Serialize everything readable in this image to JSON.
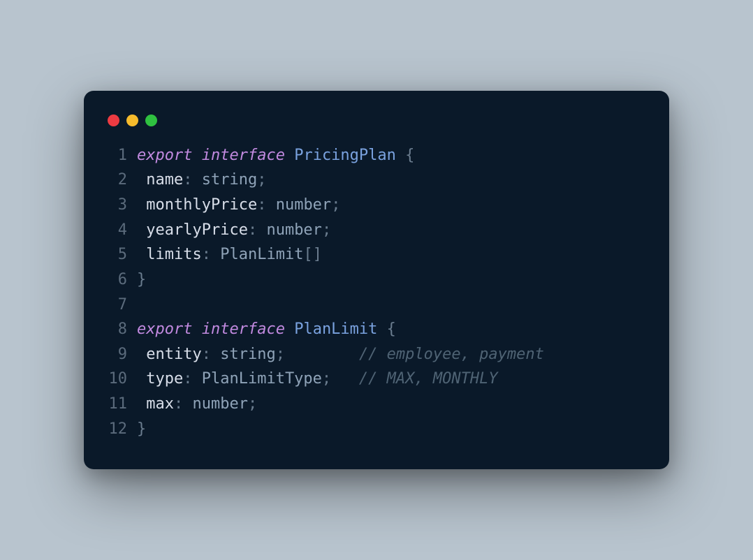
{
  "window": {
    "controls": [
      "close",
      "minimize",
      "zoom"
    ]
  },
  "code": {
    "lines": [
      {
        "n": 1,
        "tokens": [
          {
            "t": "export",
            "c": "tok-keyword"
          },
          {
            "t": " ",
            "c": ""
          },
          {
            "t": "interface",
            "c": "tok-keyword"
          },
          {
            "t": " ",
            "c": ""
          },
          {
            "t": "PricingPlan",
            "c": "tok-typename"
          },
          {
            "t": " {",
            "c": "tok-punct"
          }
        ]
      },
      {
        "n": 2,
        "tokens": [
          {
            "t": " ",
            "c": ""
          },
          {
            "t": "name",
            "c": "tok-prop"
          },
          {
            "t": ": ",
            "c": "tok-punct"
          },
          {
            "t": "string",
            "c": "tok-type"
          },
          {
            "t": ";",
            "c": "tok-punct"
          }
        ]
      },
      {
        "n": 3,
        "tokens": [
          {
            "t": " ",
            "c": ""
          },
          {
            "t": "monthlyPrice",
            "c": "tok-prop"
          },
          {
            "t": ": ",
            "c": "tok-punct"
          },
          {
            "t": "number",
            "c": "tok-type"
          },
          {
            "t": ";",
            "c": "tok-punct"
          }
        ]
      },
      {
        "n": 4,
        "tokens": [
          {
            "t": " ",
            "c": ""
          },
          {
            "t": "yearlyPrice",
            "c": "tok-prop"
          },
          {
            "t": ": ",
            "c": "tok-punct"
          },
          {
            "t": "number",
            "c": "tok-type"
          },
          {
            "t": ";",
            "c": "tok-punct"
          }
        ]
      },
      {
        "n": 5,
        "tokens": [
          {
            "t": " ",
            "c": ""
          },
          {
            "t": "limits",
            "c": "tok-prop"
          },
          {
            "t": ": ",
            "c": "tok-punct"
          },
          {
            "t": "PlanLimit",
            "c": "tok-type"
          },
          {
            "t": "[]",
            "c": "tok-punct"
          }
        ]
      },
      {
        "n": 6,
        "tokens": [
          {
            "t": "}",
            "c": "tok-punct"
          }
        ]
      },
      {
        "n": 7,
        "tokens": [
          {
            "t": "",
            "c": ""
          }
        ]
      },
      {
        "n": 8,
        "tokens": [
          {
            "t": "export",
            "c": "tok-keyword"
          },
          {
            "t": " ",
            "c": ""
          },
          {
            "t": "interface",
            "c": "tok-keyword"
          },
          {
            "t": " ",
            "c": ""
          },
          {
            "t": "PlanLimit",
            "c": "tok-typename"
          },
          {
            "t": " {",
            "c": "tok-punct"
          }
        ]
      },
      {
        "n": 9,
        "tokens": [
          {
            "t": " ",
            "c": ""
          },
          {
            "t": "entity",
            "c": "tok-prop"
          },
          {
            "t": ": ",
            "c": "tok-punct"
          },
          {
            "t": "string",
            "c": "tok-type"
          },
          {
            "t": ";",
            "c": "tok-punct"
          },
          {
            "t": "        ",
            "c": ""
          },
          {
            "t": "// employee, payment",
            "c": "tok-comment"
          }
        ]
      },
      {
        "n": 10,
        "tokens": [
          {
            "t": " ",
            "c": ""
          },
          {
            "t": "type",
            "c": "tok-prop"
          },
          {
            "t": ": ",
            "c": "tok-punct"
          },
          {
            "t": "PlanLimitType",
            "c": "tok-type"
          },
          {
            "t": ";",
            "c": "tok-punct"
          },
          {
            "t": "   ",
            "c": ""
          },
          {
            "t": "// MAX, MONTHLY",
            "c": "tok-comment"
          }
        ]
      },
      {
        "n": 11,
        "tokens": [
          {
            "t": " ",
            "c": ""
          },
          {
            "t": "max",
            "c": "tok-prop"
          },
          {
            "t": ": ",
            "c": "tok-punct"
          },
          {
            "t": "number",
            "c": "tok-type"
          },
          {
            "t": ";",
            "c": "tok-punct"
          }
        ]
      },
      {
        "n": 12,
        "tokens": [
          {
            "t": "}",
            "c": "tok-punct"
          }
        ]
      }
    ]
  }
}
